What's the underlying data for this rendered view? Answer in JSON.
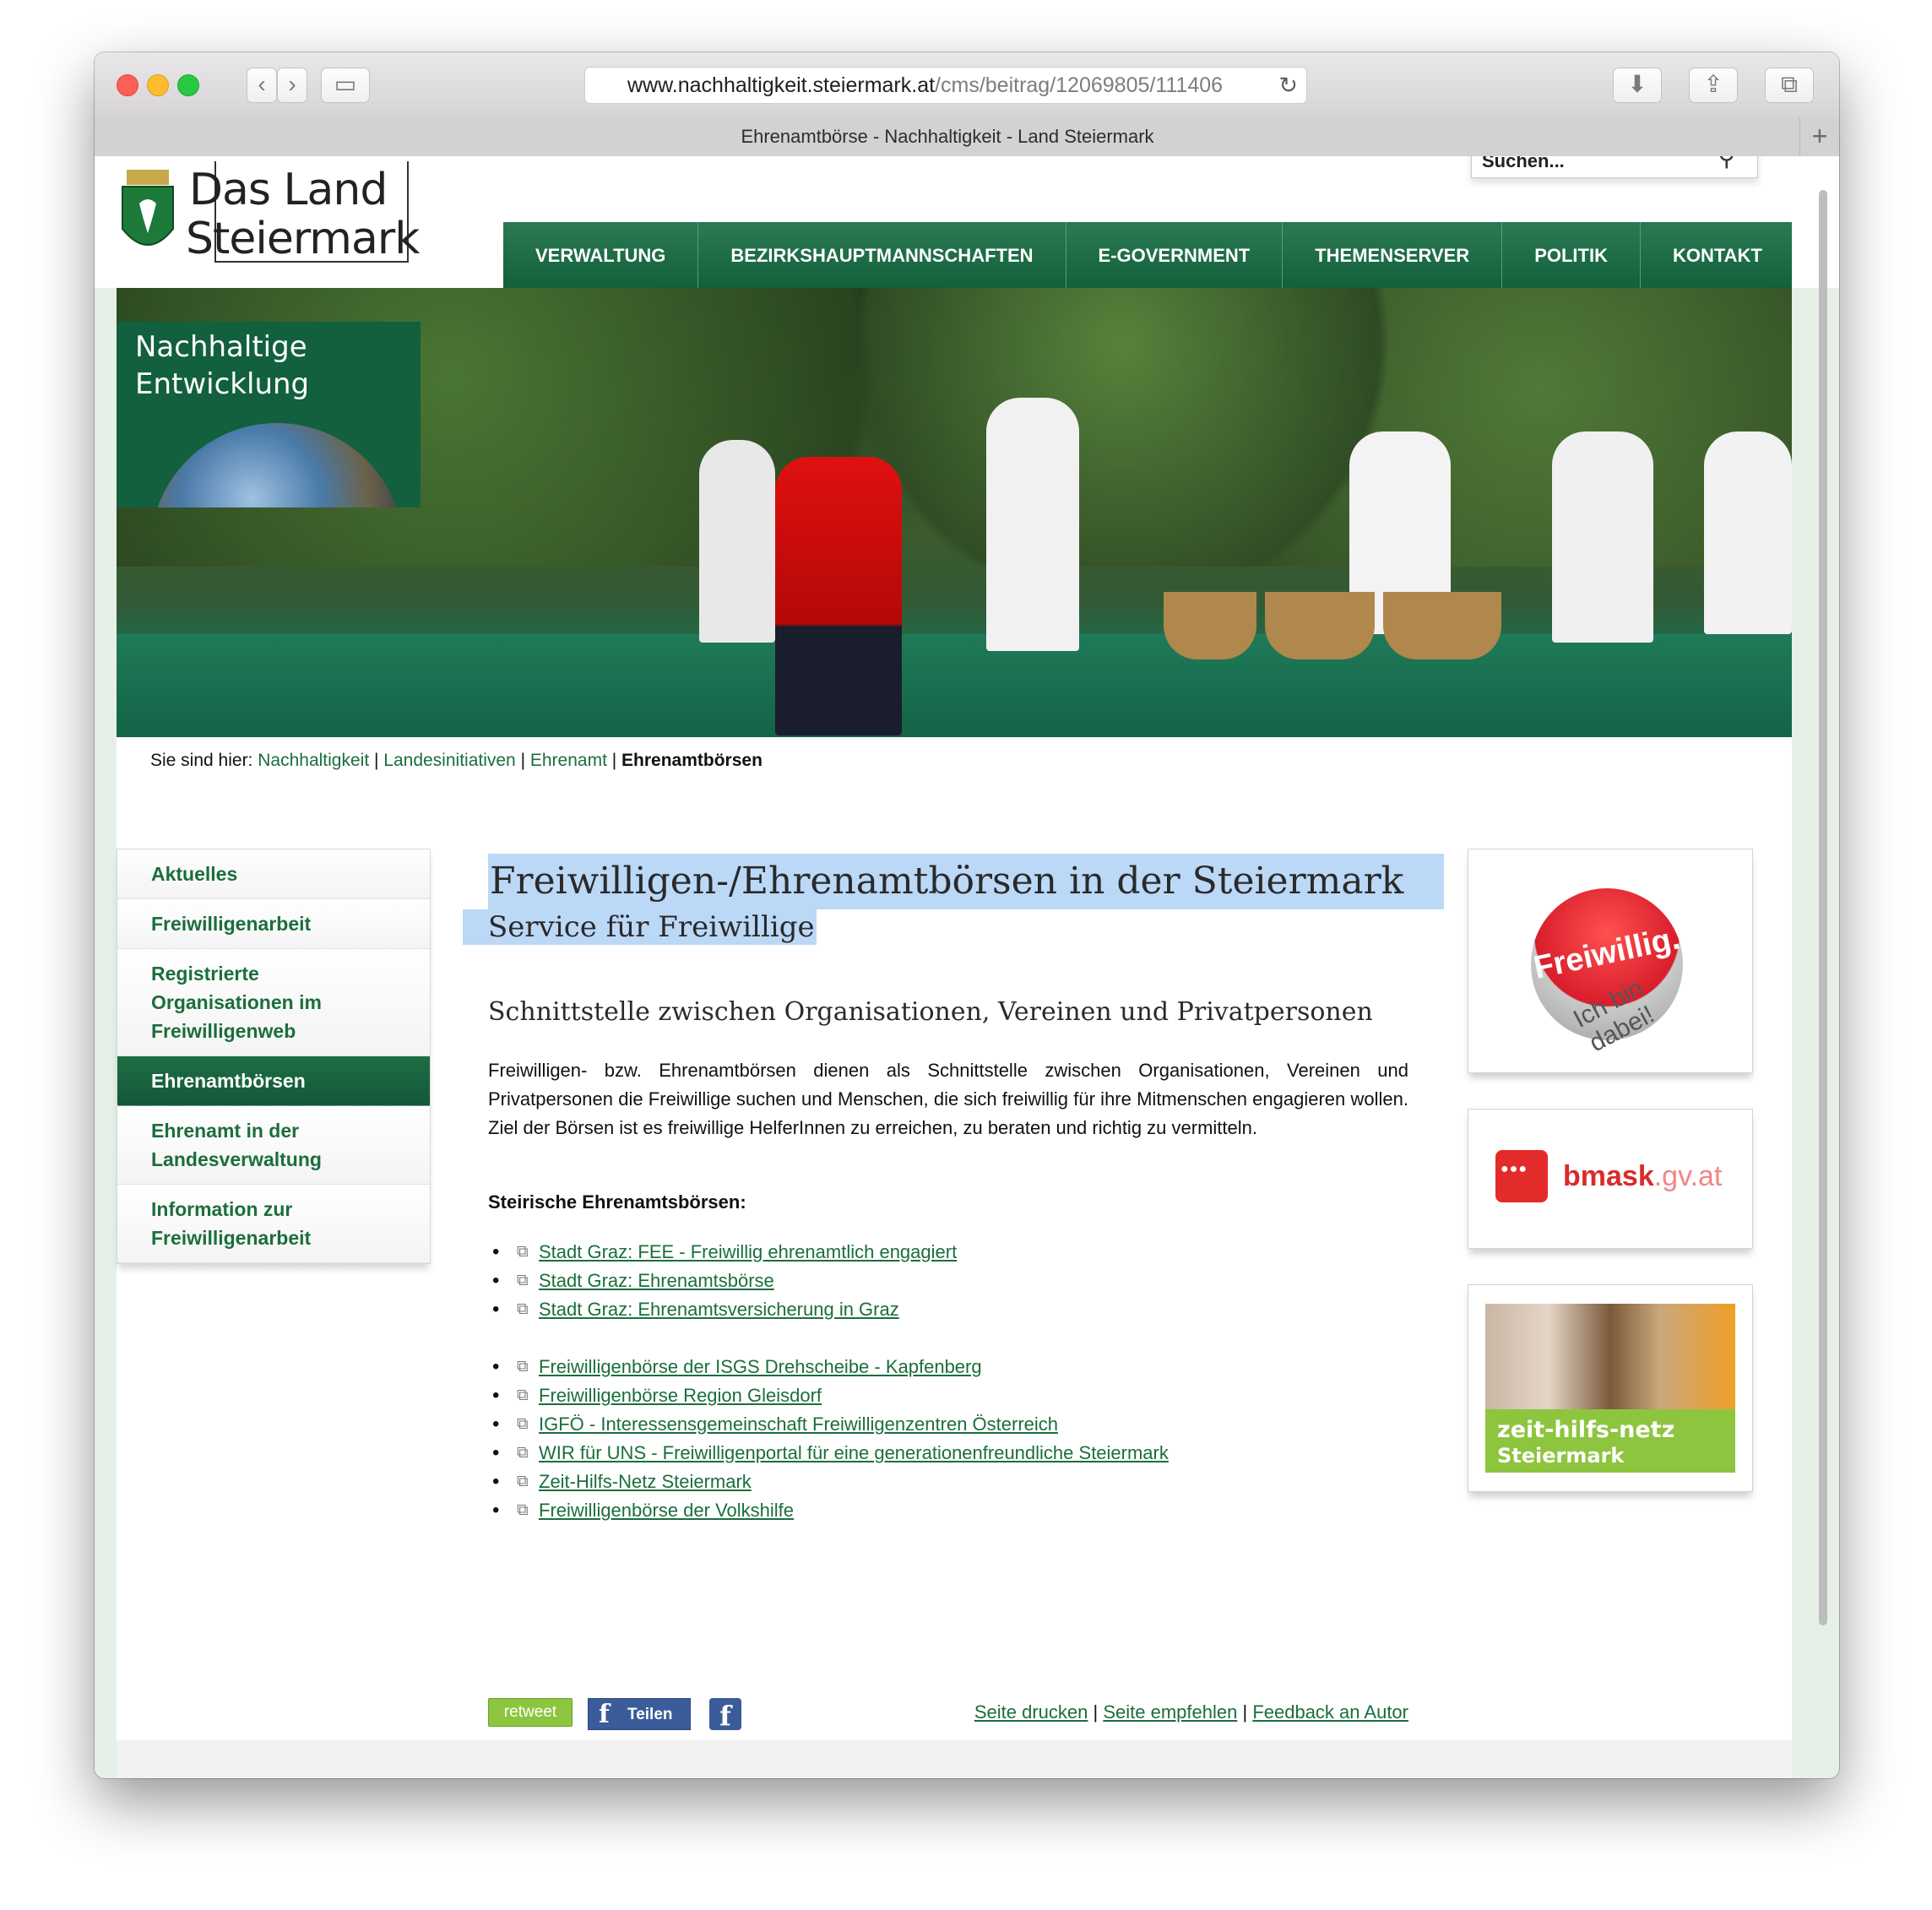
{
  "browser": {
    "url_host": "www.nachhaltigkeit.steiermark.at",
    "url_path": "/cms/beitrag/12069805/111406",
    "tab_title": "Ehrenamtbörse - Nachhaltigkeit - Land Steiermark",
    "icons": [
      "chevron-left-icon",
      "chevron-right-icon",
      "sidebar-icon",
      "reload-icon",
      "download-icon",
      "share-icon",
      "tabs-icon",
      "plus-icon"
    ]
  },
  "site": {
    "logo_line1": "Das Land",
    "logo_line2": "Steiermark",
    "search_placeholder": "Suchen...",
    "nav": [
      "VERWALTUNG",
      "BEZIRKSHAUPTMANNSCHAFTEN",
      "E-GOVERNMENT",
      "THEMENSERVER",
      "POLITIK",
      "KONTAKT"
    ],
    "hero_badge_line1": "Nachhaltige",
    "hero_badge_line2": "Entwicklung"
  },
  "breadcrumb": {
    "prefix": "Sie sind hier:",
    "items": [
      "Nachhaltigkeit",
      "Landesinitiativen",
      "Ehrenamt"
    ],
    "current": "Ehrenamtbörsen"
  },
  "sidebar": {
    "items": [
      {
        "label": "Aktuelles"
      },
      {
        "label": "Freiwilligenarbeit"
      },
      {
        "label": "Registrierte Organisationen im Freiwilligenweb"
      },
      {
        "label": "Ehrenamtbörsen"
      },
      {
        "label": "Ehrenamt in der Landesverwaltung"
      },
      {
        "label": "Information zur Freiwilligenarbeit"
      }
    ]
  },
  "main": {
    "title": "Freiwilligen-/Ehrenamtbörsen in der Steiermark",
    "subtitle": "Service für Freiwillige",
    "section_heading": "Schnittstelle zwischen Organisationen, Vereinen und Privatpersonen",
    "paragraph": "Freiwilligen- bzw. Ehrenamtbörsen dienen als Schnittstelle zwischen Organisationen, Vereinen und Privatpersonen die Freiwillige suchen und Menschen, die sich freiwillig für ihre Mitmenschen engagieren wollen. Ziel der Börsen ist es freiwillige HelferInnen zu erreichen, zu beraten und richtig zu vermitteln.",
    "list_heading": "Steirische Ehrenamtsbörsen:",
    "links_group1": [
      "Stadt Graz: FEE - Freiwillig ehrenamtlich engagiert",
      "Stadt Graz: Ehrenamtsbörse",
      "Stadt Graz: Ehrenamtsversicherung in Graz"
    ],
    "links_group2": [
      "Freiwilligenbörse der ISGS Drehscheibe - Kapfenberg",
      "Freiwilligenbörse Region Gleisdorf",
      "IGFÖ - Interessensgemeinschaft Freiwilligenzentren Österreich",
      "WIR für UNS - Freiwilligenportal für eine generationenfreundliche Steiermark",
      "Zeit-Hilfs-Netz Steiermark",
      "Freiwilligenbörse der Volkshilfe"
    ],
    "social": {
      "retweet": "retweet",
      "fb_share": "Teilen"
    },
    "footer_links": [
      "Seite drucken",
      "Seite empfehlen",
      "Feedback an Autor"
    ],
    "separator": "|"
  },
  "right_boxes": {
    "freiwillig_main": "Freiwillig.",
    "freiwillig_sub": "Ich bin dabei!",
    "bmask_main": "bmask",
    "bmask_suffix": ".gv.at",
    "zhn_line1": "zeit-hilfs-netz",
    "zhn_line2": "Steiermark"
  }
}
